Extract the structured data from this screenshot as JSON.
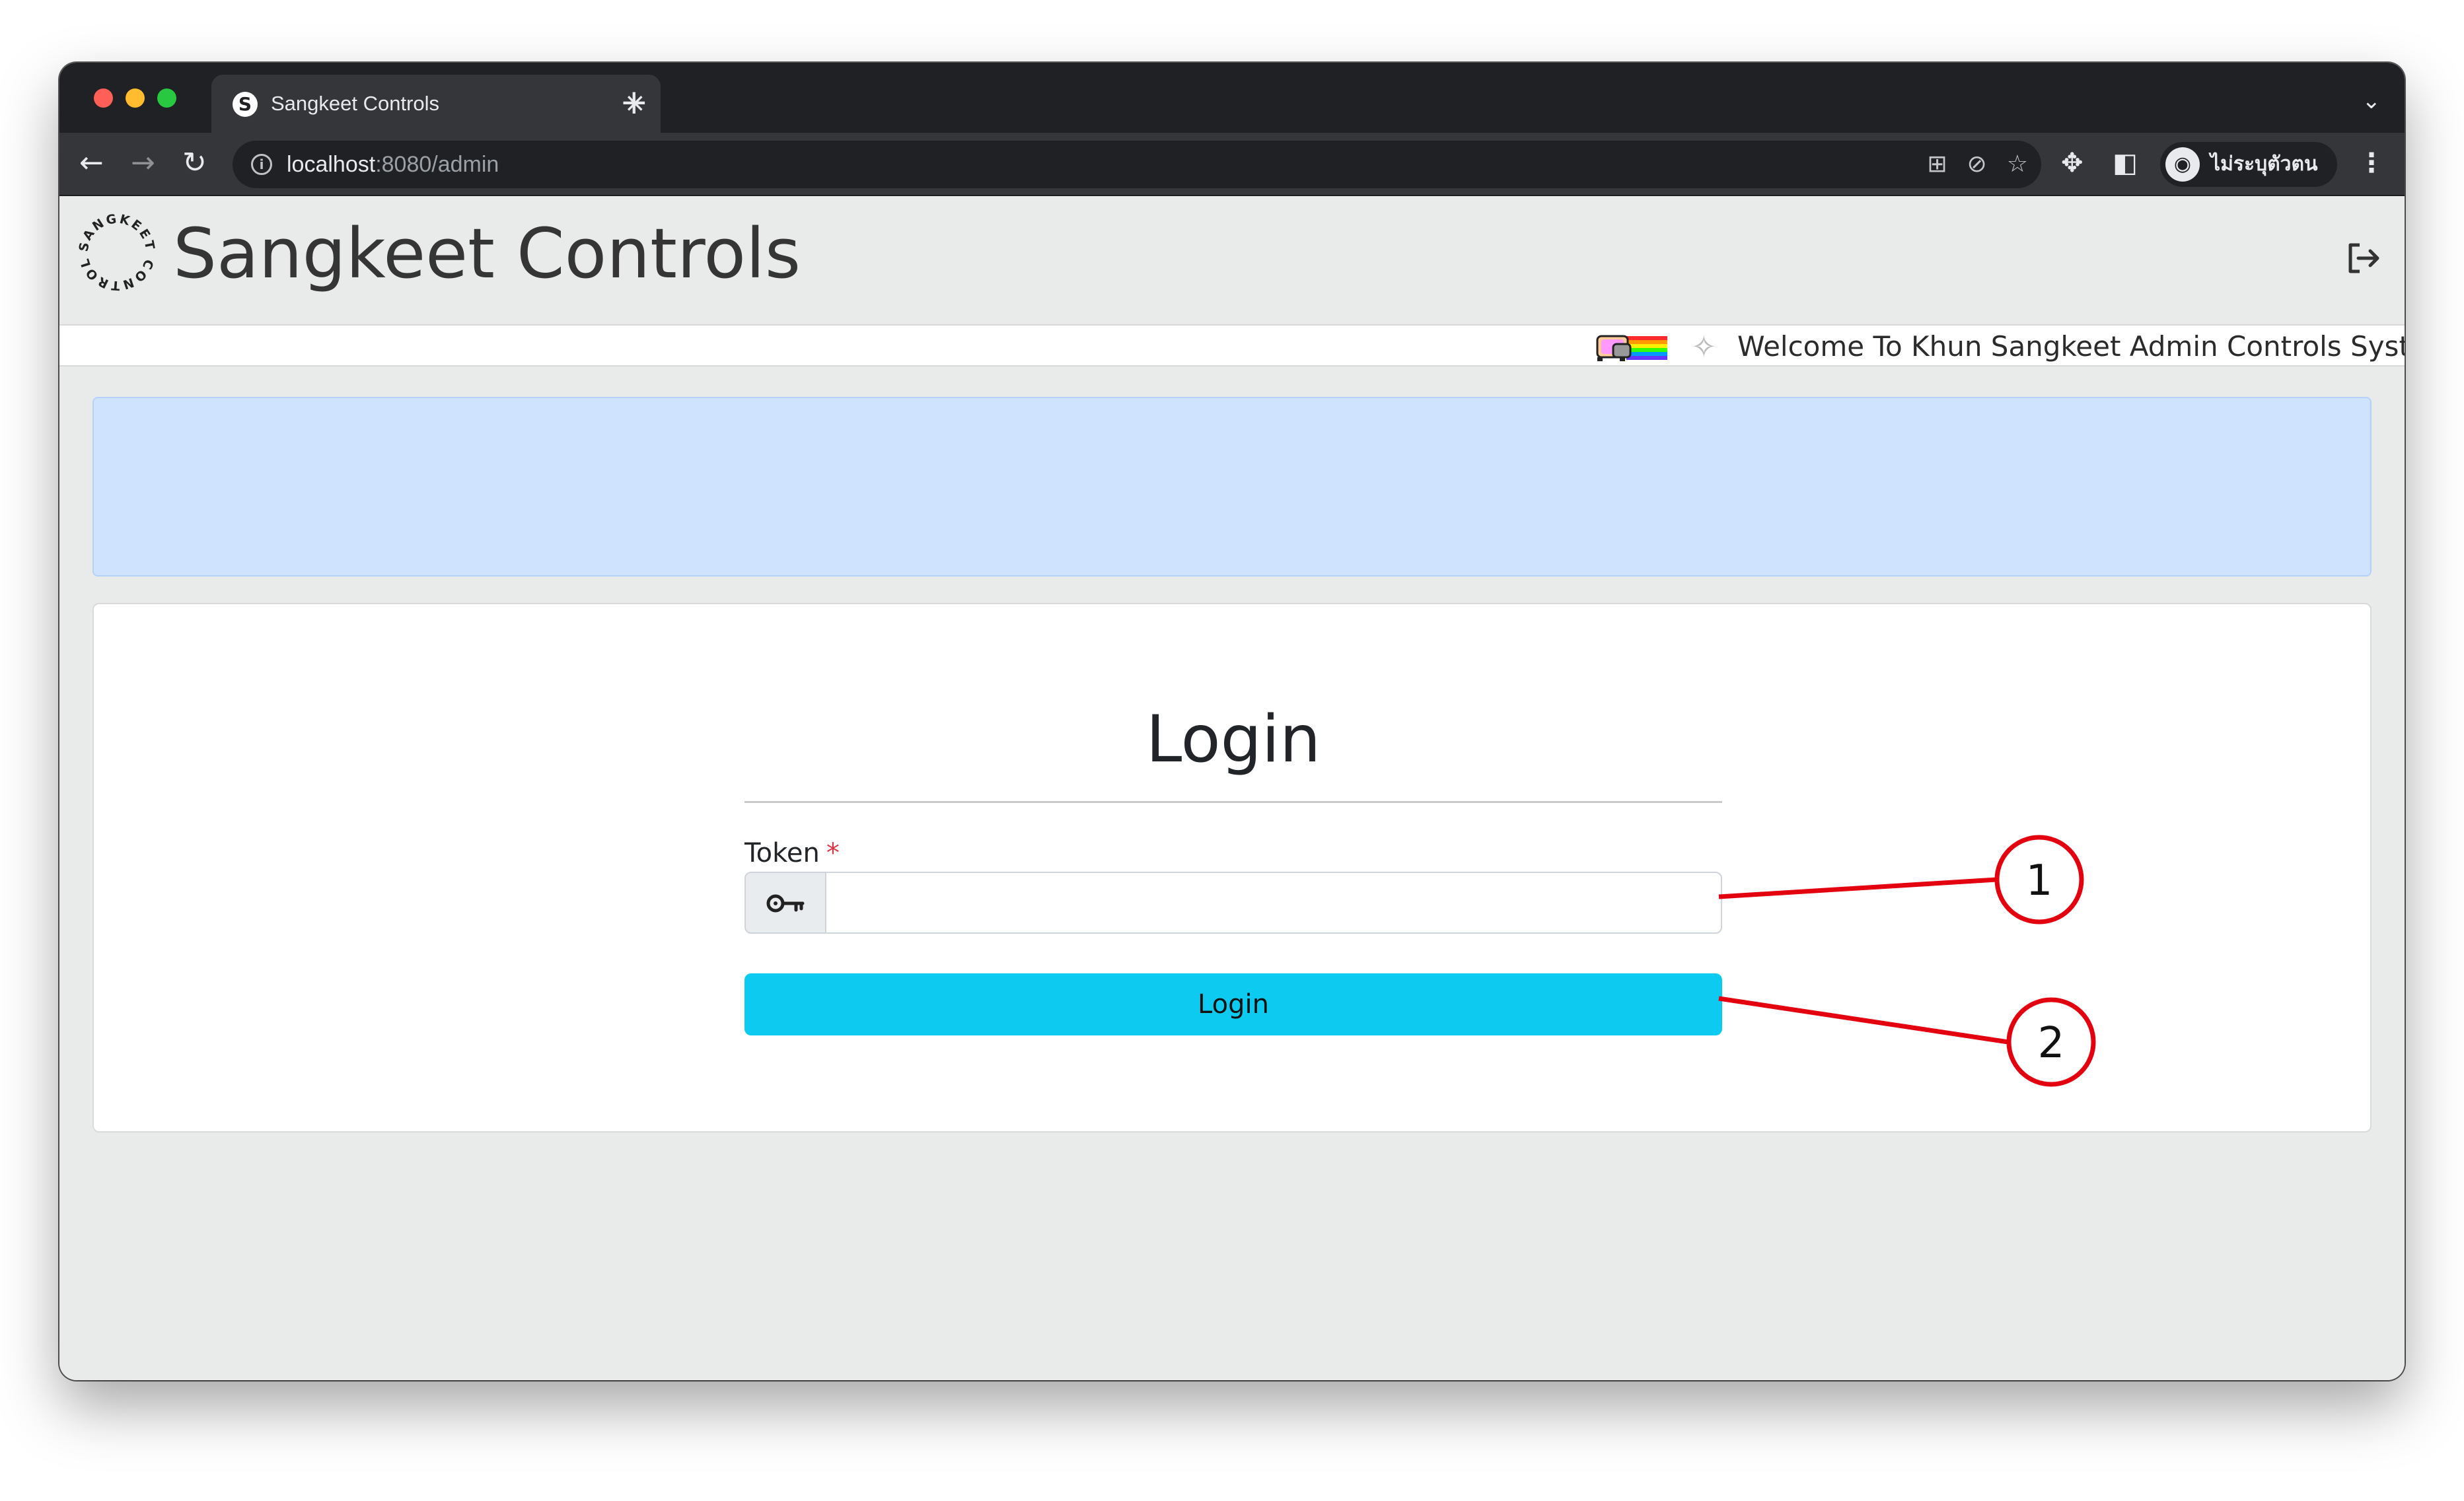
{
  "browser": {
    "tab_title": "Sangkeet Controls",
    "tab_favicon": "S",
    "tab_close": "×",
    "new_tab": "+",
    "tab_search": "⌄",
    "url_host": "localhost",
    "url_path": ":8080/admin",
    "profile_label": "ไม่ระบุตัวตน",
    "icons": [
      "back-arrow-icon",
      "forward-arrow-icon",
      "reload-icon",
      "info-icon",
      "translate-icon",
      "eye-off-icon",
      "star-icon",
      "puzzle-icon",
      "side-panel-icon",
      "incognito-icon",
      "kebab-menu-icon"
    ]
  },
  "header": {
    "title": "Sangkeet Controls",
    "logo_text": "SANGKEET CONTROL"
  },
  "marquee": {
    "text": "Welcome To Khun Sangkeet Admin Controls System St"
  },
  "login": {
    "title": "Login",
    "token_label": "Token",
    "required_mark": "*",
    "token_value": "",
    "button_label": "Login"
  },
  "annotations": {
    "callouts": [
      "1",
      "2"
    ],
    "color": "#e3000f"
  },
  "colors": {
    "alert_bg": "#cfe2fe",
    "button_bg": "#0dcaf0",
    "page_bg": "#e9eaea"
  }
}
